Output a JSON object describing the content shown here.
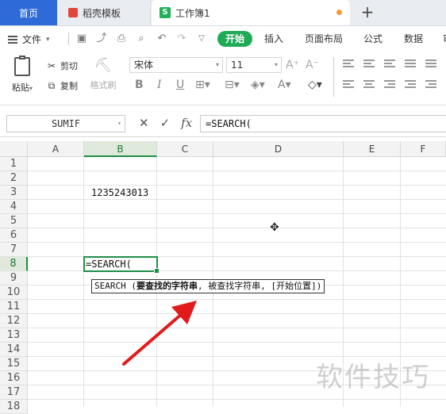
{
  "tabs": {
    "home": "首页",
    "docer": "稻壳模板",
    "workbook": "工作簿1",
    "workbook_icon": "S",
    "add": "+"
  },
  "menu": {
    "file": "文件",
    "ribbon_tabs": [
      "开始",
      "插入",
      "页面布局",
      "公式",
      "数据",
      "审"
    ]
  },
  "ribbon": {
    "paste": "粘贴",
    "cut": "剪切",
    "copy": "复制",
    "format_painter": "格式刷",
    "font_name": "宋体",
    "font_size": "11",
    "bold": "B",
    "italic": "I",
    "underline": "U"
  },
  "formula_bar": {
    "name_box": "SUMIF",
    "fx_label": "fx",
    "formula": "=SEARCH("
  },
  "grid": {
    "columns": [
      "A",
      "B",
      "C",
      "D",
      "E",
      "F"
    ],
    "selected_column": "B",
    "rows": [
      "1",
      "2",
      "3",
      "4",
      "5",
      "6",
      "7",
      "8",
      "9",
      "10",
      "11",
      "12",
      "13",
      "14",
      "15",
      "16",
      "17",
      "18"
    ],
    "selected_row": "8",
    "cells": {
      "B3": "1235243013",
      "B8": "=SEARCH("
    },
    "tooltip": {
      "func": "SEARCH (",
      "arg_current": "要查找的字符串",
      "rest": ", 被查找字符串, [开始位置])"
    }
  },
  "watermark": "软件技巧"
}
